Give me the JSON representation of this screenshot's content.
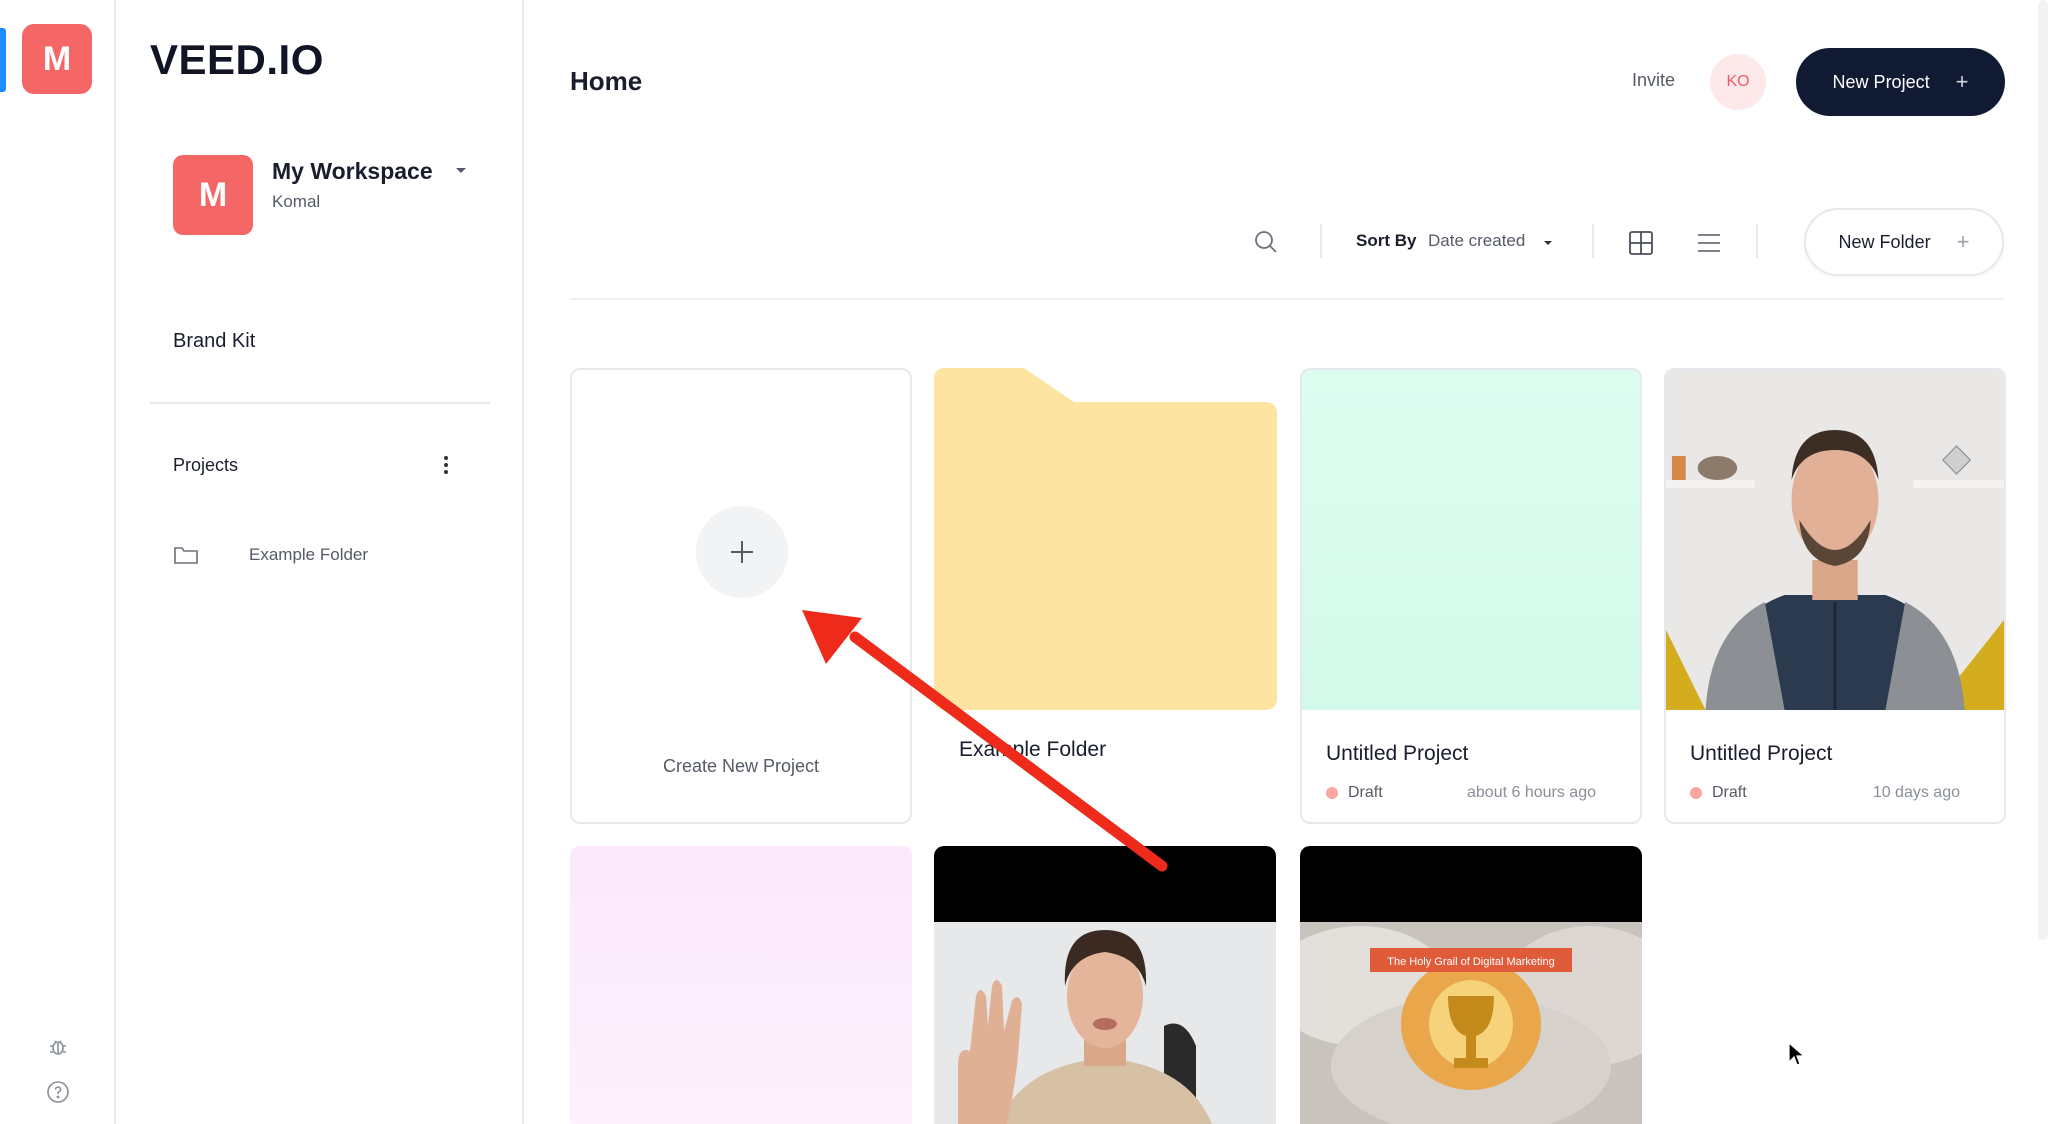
{
  "rail": {
    "avatar_letter": "M",
    "icons": [
      "bug-icon",
      "help-icon"
    ]
  },
  "sidebar": {
    "logo": "VEED.IO",
    "workspace": {
      "avatar_letter": "M",
      "name": "My Workspace",
      "user": "Komal"
    },
    "brand_kit": "Brand Kit",
    "projects_heading": "Projects",
    "folders": [
      {
        "label": "Example Folder"
      }
    ]
  },
  "header": {
    "title": "Home",
    "invite": "Invite",
    "user_initials": "KO",
    "new_project": "New Project"
  },
  "toolbar": {
    "sort_label": "Sort By",
    "sort_value": "Date created",
    "new_folder": "New Folder"
  },
  "cards": {
    "create_label": "Create New Project",
    "folder_label": "Example Folder",
    "projects": [
      {
        "title": "Untitled Project",
        "status": "Draft",
        "time": "about 6 hours ago"
      },
      {
        "title": "Untitled Project",
        "status": "Draft",
        "time": "10 days ago"
      }
    ],
    "banner_text": "The Holy Grail of Digital Marketing"
  },
  "colors": {
    "accent_red": "#f56767",
    "navy": "#111a33",
    "folder_yellow": "#fde5a1",
    "mint": "#d9fbee",
    "arrow_red": "#ee2a1b"
  }
}
